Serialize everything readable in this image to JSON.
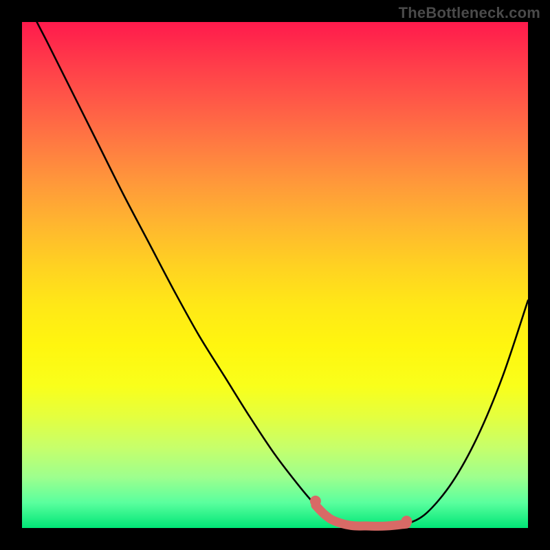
{
  "watermark": "TheBottleneck.com",
  "colors": {
    "frame": "#000000",
    "grad_top": "#ff1a4c",
    "grad_bottom": "#00e676",
    "curve": "#000000",
    "marker": "#d86a66"
  },
  "chart_data": {
    "type": "line",
    "title": "",
    "xlabel": "",
    "ylabel": "",
    "xlim": [
      0,
      100
    ],
    "ylim": [
      0,
      100
    ],
    "grid": false,
    "legend": false,
    "x": [
      0,
      2,
      5,
      10,
      15,
      20,
      25,
      30,
      35,
      40,
      45,
      50,
      55,
      58,
      60,
      62,
      65,
      68,
      72,
      76,
      80,
      85,
      90,
      95,
      100
    ],
    "values": [
      108,
      102,
      96,
      86,
      76,
      66,
      56.5,
      47,
      38,
      30,
      22,
      14.5,
      8,
      4.5,
      2.5,
      1.3,
      0.5,
      0.2,
      0.2,
      0.8,
      3,
      9,
      18,
      30,
      45
    ],
    "optimal_band": {
      "x_start": 58,
      "x_end": 78,
      "y_level": 0.4
    }
  }
}
